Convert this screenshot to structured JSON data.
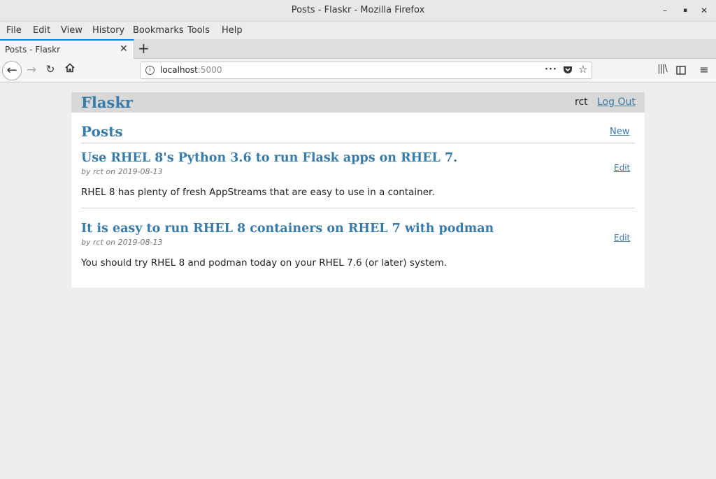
{
  "window": {
    "title": "Posts - Flaskr - Mozilla Firefox"
  },
  "menu": [
    "File",
    "Edit",
    "View",
    "History",
    "Bookmarks",
    "Tools",
    "Help"
  ],
  "tab": {
    "title": "Posts - Flaskr"
  },
  "url": {
    "host": "localhost",
    "port": ":5000"
  },
  "site": {
    "brand": "Flaskr",
    "user": "rct",
    "logout": "Log Out",
    "heading": "Posts",
    "new_label": "New",
    "edit_label": "Edit"
  },
  "posts": [
    {
      "title": "Use RHEL 8's Python 3.6 to run Flask apps on RHEL 7.",
      "meta": "by rct on 2019-08-13",
      "body": "RHEL 8 has plenty of fresh AppStreams that are easy to use in a container."
    },
    {
      "title": "It is easy to run RHEL 8 containers on RHEL 7 with podman",
      "meta": "by rct on 2019-08-13",
      "body": "You should try RHEL 8 and podman today on your RHEL 7.6 (or later) system."
    }
  ]
}
